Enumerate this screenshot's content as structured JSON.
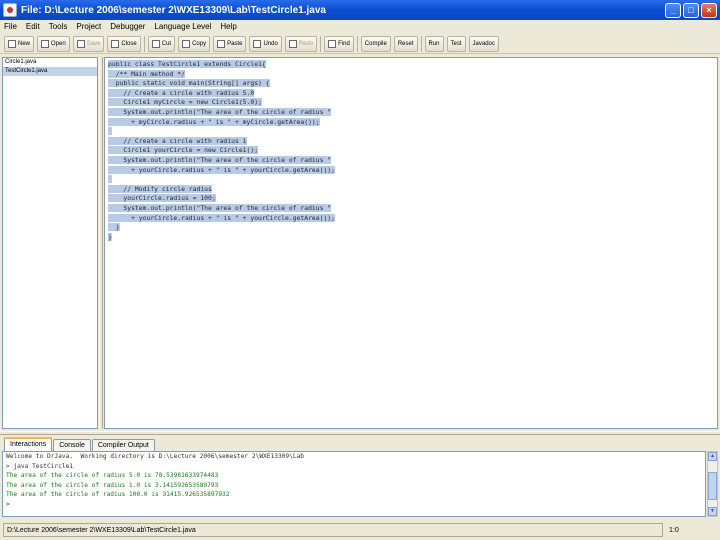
{
  "window": {
    "title": "File: D:\\Lecture 2006\\semester 2\\WXE13309\\Lab\\TestCircle1.java",
    "buttons": {
      "minimize": "_",
      "maximize": "□",
      "close": "×"
    }
  },
  "menu": [
    "File",
    "Edit",
    "Tools",
    "Project",
    "Debugger",
    "Language Level",
    "Help"
  ],
  "toolbar": [
    {
      "label": "New",
      "icon": "new-file-icon",
      "enabled": true
    },
    {
      "label": "Open",
      "icon": "open-folder-icon",
      "enabled": true
    },
    {
      "label": "Save",
      "icon": "save-icon",
      "enabled": false
    },
    {
      "label": "Close",
      "icon": "close-file-icon",
      "enabled": true
    },
    {
      "label": "Cut",
      "icon": "cut-icon",
      "enabled": true
    },
    {
      "label": "Copy",
      "icon": "copy-icon",
      "enabled": true
    },
    {
      "label": "Paste",
      "icon": "paste-icon",
      "enabled": true
    },
    {
      "label": "Undo",
      "icon": "undo-icon",
      "enabled": true
    },
    {
      "label": "Redo",
      "icon": "redo-icon",
      "enabled": false
    },
    {
      "label": "Find",
      "icon": "find-icon",
      "enabled": true
    },
    {
      "label": "Compile",
      "icon": "",
      "enabled": true
    },
    {
      "label": "Reset",
      "icon": "",
      "enabled": true
    },
    {
      "label": "Run",
      "icon": "",
      "enabled": true
    },
    {
      "label": "Test",
      "icon": "",
      "enabled": true
    },
    {
      "label": "Javadoc",
      "icon": "",
      "enabled": true
    }
  ],
  "files": [
    {
      "name": "Circle1.java",
      "selected": false
    },
    {
      "name": "TestCircle1.java",
      "selected": true
    }
  ],
  "editor": {
    "lines": [
      "public class TestCircle1 extends Circle1{",
      "  /** Main method */",
      "  public static void main(String[] args) {",
      "    // Create a circle with radius 5.0",
      "    Circle1 myCircle = new Circle1(5.0);",
      "    System.out.println(\"The area of the circle of radius \"",
      "      + myCircle.radius + \" is \" + myCircle.getArea());",
      "",
      "    // Create a circle with radius 1",
      "    Circle1 yourCircle = new Circle1();",
      "    System.out.println(\"The area of the circle of radius \"",
      "      + yourCircle.radius + \" is \" + yourCircle.getArea());",
      "",
      "    // Modify circle radius",
      "    yourCircle.radius = 100;",
      "    System.out.println(\"The area of the circle of radius \"",
      "      + yourCircle.radius + \" is \" + yourCircle.getArea());",
      "  }",
      "}"
    ]
  },
  "tabs": [
    {
      "label": "Interactions",
      "active": true
    },
    {
      "label": "Console",
      "active": false
    },
    {
      "label": "Compiler Output",
      "active": false
    }
  ],
  "console": {
    "lines": [
      {
        "text": "Welcome to DrJava.  Working directory is D:\\Lecture 2006\\semester 2\\WXE13309\\Lab",
        "kind": "sys"
      },
      {
        "text": "> java TestCircle1",
        "kind": "sys"
      },
      {
        "text": "The area of the circle of radius 5.0 is 78.53981633974483",
        "kind": "out"
      },
      {
        "text": "The area of the circle of radius 1.0 is 3.141592653589793",
        "kind": "out"
      },
      {
        "text": "The area of the circle of radius 100.0 is 31415.926535897932",
        "kind": "out"
      },
      {
        "text": ">",
        "kind": "sys"
      }
    ]
  },
  "status": {
    "path": "D:\\Lecture 2006\\semester 2\\WXE13309\\Lab\\TestCircle1.java",
    "position": "1:0"
  }
}
